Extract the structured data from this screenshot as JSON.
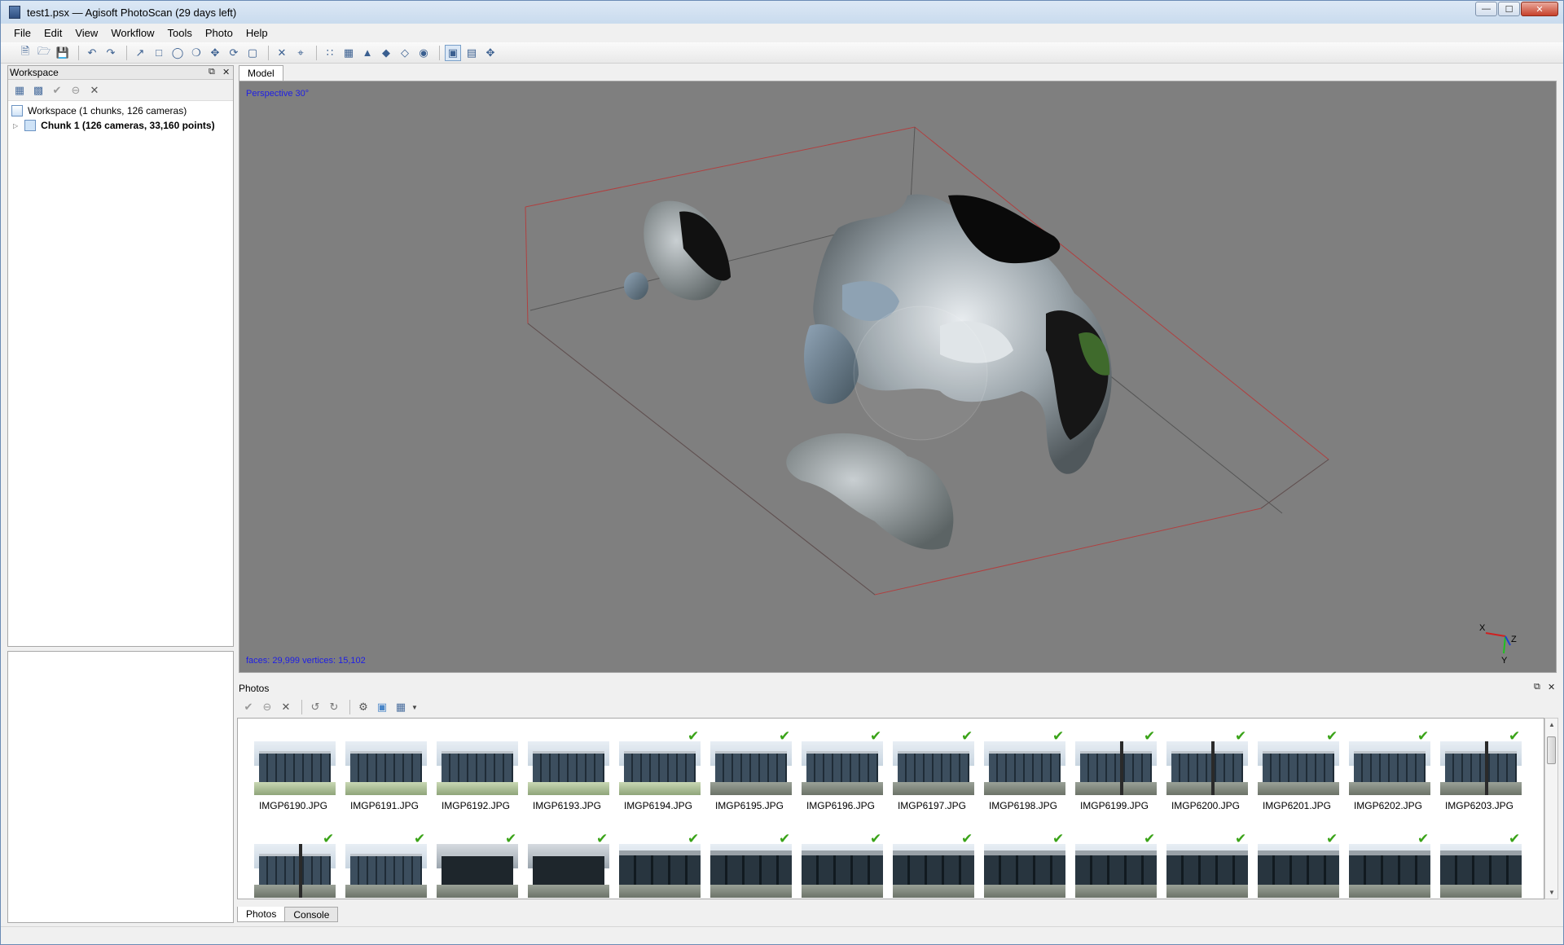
{
  "window": {
    "title": "test1.psx — Agisoft PhotoScan (29 days left)"
  },
  "menu": {
    "items": [
      "File",
      "Edit",
      "View",
      "Workflow",
      "Tools",
      "Photo",
      "Help"
    ]
  },
  "toolbar": {
    "icons": [
      "new-icon",
      "open-icon",
      "save-icon",
      "sep",
      "undo-icon",
      "redo-icon",
      "sep",
      "navigation-icon",
      "rect-select-icon",
      "ellipse-select-icon",
      "free-select-icon",
      "move-region-icon",
      "rotate-region-icon",
      "resize-region-icon",
      "sep",
      "delete-icon",
      "crop-icon",
      "sep",
      "point-cloud-icon",
      "dense-cloud-icon",
      "shaded-model-icon",
      "solid-model-icon",
      "wireframe-icon",
      "textured-model-icon",
      "sep",
      "show-cameras-icon",
      "show-region-icon",
      "reset-view-icon"
    ],
    "active_index": 25
  },
  "workspace": {
    "panel_title": "Workspace",
    "root_label": "Workspace (1 chunks, 126 cameras)",
    "chunk_label": "Chunk 1 (126 cameras, 33,160 points)"
  },
  "model": {
    "tab_label": "Model",
    "projection_label": "Perspective 30°",
    "stats_label": "faces: 29,999 vertices: 15,102",
    "axis_labels": {
      "x": "X",
      "y": "Y",
      "z": "Z"
    }
  },
  "photos": {
    "panel_title": "Photos",
    "row1": [
      {
        "name": "IMGP6190.JPG",
        "aligned": false,
        "style": "grass"
      },
      {
        "name": "IMGP6191.JPG",
        "aligned": false,
        "style": "grass"
      },
      {
        "name": "IMGP6192.JPG",
        "aligned": false,
        "style": "grass"
      },
      {
        "name": "IMGP6193.JPG",
        "aligned": false,
        "style": "grass"
      },
      {
        "name": "IMGP6194.JPG",
        "aligned": true,
        "style": "grass"
      },
      {
        "name": "IMGP6195.JPG",
        "aligned": true,
        "style": "normal"
      },
      {
        "name": "IMGP6196.JPG",
        "aligned": true,
        "style": "normal"
      },
      {
        "name": "IMGP6197.JPG",
        "aligned": true,
        "style": "normal"
      },
      {
        "name": "IMGP6198.JPG",
        "aligned": true,
        "style": "normal"
      },
      {
        "name": "IMGP6199.JPG",
        "aligned": true,
        "style": "pole"
      },
      {
        "name": "IMGP6200.JPG",
        "aligned": true,
        "style": "pole"
      },
      {
        "name": "IMGP6201.JPG",
        "aligned": true,
        "style": "normal"
      },
      {
        "name": "IMGP6202.JPG",
        "aligned": true,
        "style": "normal"
      },
      {
        "name": "IMGP6203.JPG",
        "aligned": true,
        "style": "pole"
      }
    ],
    "row2_aligned": [
      true,
      true,
      true,
      true,
      true,
      true,
      true,
      true,
      true,
      true,
      true,
      true,
      true,
      true
    ],
    "row2_styles": [
      "pole",
      "normal",
      "dark",
      "dark",
      "close",
      "close",
      "close",
      "close",
      "close",
      "close",
      "close",
      "close",
      "close",
      "close"
    ]
  },
  "bottom_tabs": [
    "Photos",
    "Console"
  ],
  "colors": {
    "viewport_bg": "#7f7f7f",
    "label_blue": "#1e1ee6",
    "check_green": "#3aa318",
    "region_box": "#b04040"
  }
}
